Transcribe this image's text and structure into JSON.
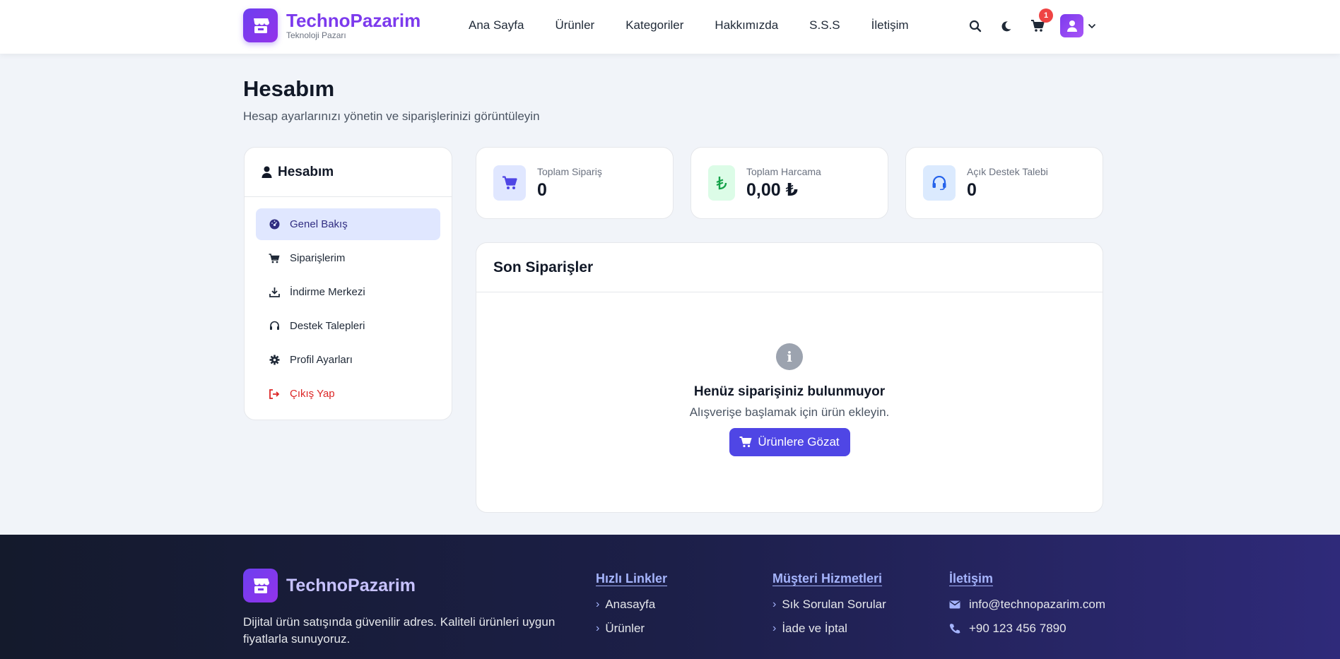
{
  "header": {
    "brand": "TechnoPazarim",
    "tagline": "Teknoloji Pazarı",
    "nav": [
      "Ana Sayfa",
      "Ürünler",
      "Kategoriler",
      "Hakkımızda",
      "S.S.S",
      "İletişim"
    ],
    "cart_count": "1"
  },
  "page": {
    "title": "Hesabım",
    "subtitle": "Hesap ayarlarınızı yönetin ve siparişlerinizi görüntüleyin"
  },
  "sidebar": {
    "title": "Hesabım",
    "items": [
      {
        "label": "Genel Bakış",
        "icon": "dashboard-icon"
      },
      {
        "label": "Siparişlerim",
        "icon": "cart-icon"
      },
      {
        "label": "İndirme Merkezi",
        "icon": "download-icon"
      },
      {
        "label": "Destek Talepleri",
        "icon": "headset-icon"
      },
      {
        "label": "Profil Ayarları",
        "icon": "gear-icon"
      },
      {
        "label": "Çıkış Yap",
        "icon": "logout-icon"
      }
    ]
  },
  "stats": [
    {
      "label": "Toplam Sipariş",
      "value": "0"
    },
    {
      "label": "Toplam Harcama",
      "value": "0,00 ₺"
    },
    {
      "label": "Açık Destek Talebi",
      "value": "0"
    }
  ],
  "orders": {
    "title": "Son Siparişler",
    "empty_title": "Henüz siparişiniz bulunmuyor",
    "empty_sub": "Alışverişe başlamak için ürün ekleyin.",
    "browse_label": "Ürünlere Gözat",
    "info_glyph": "i"
  },
  "footer": {
    "brand": "TechnoPazarim",
    "desc": "Dijital ürün satışında güvenilir adres. Kaliteli ürünleri uygun fiyatlarla sunuyoruz.",
    "quick_title": "Hızlı Linkler",
    "quick_links": [
      "Anasayfa",
      "Ürünler"
    ],
    "service_title": "Müşteri Hizmetleri",
    "service_links": [
      "Sık Sorulan Sorular",
      "İade ve İptal"
    ],
    "contact_title": "İletişim",
    "email": "info@technopazarim.com",
    "phone": "+90 123 456 7890"
  },
  "colors": {
    "accent": "#4f46e5",
    "brand": "#7c3aed",
    "danger": "#dc2626",
    "badge": "#ef4444"
  }
}
